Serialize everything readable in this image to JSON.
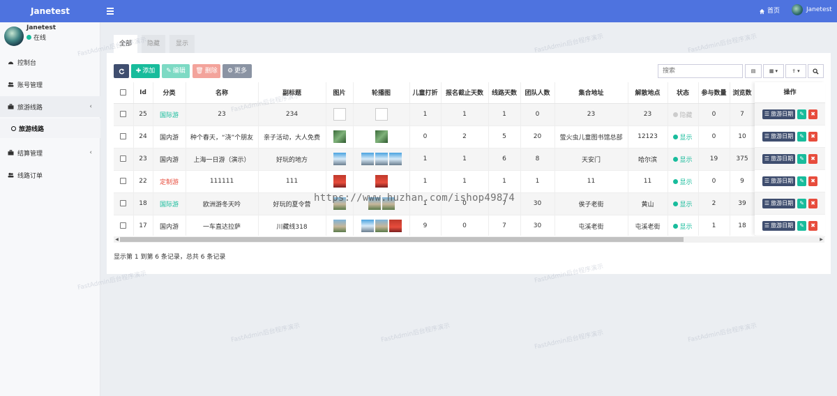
{
  "app": {
    "brand": "Janetest"
  },
  "topbar": {
    "home_label": "首页",
    "user_name": "Janetest"
  },
  "sidebar": {
    "user_name": "Janetest",
    "status": "在线",
    "items": [
      {
        "label": "控制台"
      },
      {
        "label": "账号管理"
      },
      {
        "label": "旅游线路"
      },
      {
        "label": "结算管理"
      },
      {
        "label": "线路订单"
      }
    ],
    "sub_item": "旅游线路"
  },
  "tabs": [
    "全部",
    "隐藏",
    "显示"
  ],
  "toolbar": {
    "add": "添加",
    "edit": "编辑",
    "delete": "删除",
    "more": "更多"
  },
  "search": {
    "placeholder": "搜索"
  },
  "table": {
    "headers": [
      "Id",
      "分类",
      "名称",
      "副标题",
      "图片",
      "轮播图",
      "儿童打折",
      "报名截止天数",
      "线路天数",
      "团队人数",
      "集合地址",
      "解散地点",
      "状态",
      "参与数量",
      "浏览数"
    ],
    "op_header": "操作",
    "rows": [
      {
        "id": "25",
        "category": "国际游",
        "name": "23",
        "subtitle": "234",
        "children": "1",
        "deadline": "1",
        "days": "1",
        "team": "0",
        "meet": "23",
        "dismiss": "23",
        "status": "隐藏",
        "joined": "0",
        "views": "7"
      },
      {
        "id": "24",
        "category": "国内游",
        "name": "种个春天，“浇”个朋友",
        "subtitle": "亲子活动，大人免费",
        "children": "0",
        "deadline": "2",
        "days": "5",
        "team": "20",
        "meet": "萤火虫儿童图书馆总部",
        "dismiss": "12123",
        "status": "显示",
        "joined": "0",
        "views": "10"
      },
      {
        "id": "23",
        "category": "国内游",
        "name": "上海一日游（演示）",
        "subtitle": "好玩的地方",
        "children": "1",
        "deadline": "1",
        "days": "6",
        "team": "8",
        "meet": "天安门",
        "dismiss": "哈尔滨",
        "status": "显示",
        "joined": "19",
        "views": "375"
      },
      {
        "id": "22",
        "category": "定制游",
        "name": "111111",
        "subtitle": "111",
        "children": "1",
        "deadline": "1",
        "days": "1",
        "team": "1",
        "meet": "11",
        "dismiss": "11",
        "status": "显示",
        "joined": "0",
        "views": "9"
      },
      {
        "id": "18",
        "category": "国际游",
        "name": "欧洲游冬天吟",
        "subtitle": "好玩的夏令营",
        "children": "1",
        "deadline": "0",
        "days": "7",
        "team": "30",
        "meet": "俟子老街",
        "dismiss": "黄山",
        "status": "显示",
        "joined": "2",
        "views": "39"
      },
      {
        "id": "17",
        "category": "国内游",
        "name": "一车直达拉萨",
        "subtitle": "川藏线318",
        "children": "9",
        "deadline": "0",
        "days": "7",
        "team": "30",
        "meet": "屯溪老街",
        "dismiss": "屯溪老街",
        "status": "显示",
        "joined": "1",
        "views": "18"
      }
    ],
    "op_date_label": "旅游日期"
  },
  "footer": {
    "info": "显示第 1 到第 6 条记录，总共 6 条记录"
  },
  "overlay": {
    "url_watermark": "https://www.huzhan.com/ishop49874",
    "bg_watermark": "FastAdmin后台程序演示"
  },
  "colors": {
    "primary": "#4e73df",
    "success": "#18bc9c",
    "danger": "#e74c3c",
    "dark": "#3f4e6f"
  }
}
